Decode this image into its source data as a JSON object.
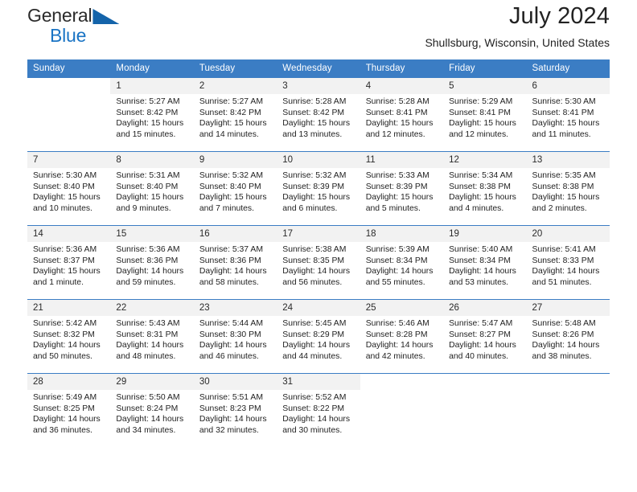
{
  "brand": {
    "name_top": "General",
    "name_bottom": "Blue",
    "triangle_color": "#1464aa",
    "bottom_color": "#1a74c4"
  },
  "header": {
    "title": "July 2024",
    "subtitle": "Shullsburg, Wisconsin, United States"
  },
  "theme": {
    "header_bg": "#3b7dc4",
    "daynum_bg": "#f2f2f2",
    "row_border": "#3b7dc4"
  },
  "weekday_headers": [
    "Sunday",
    "Monday",
    "Tuesday",
    "Wednesday",
    "Thursday",
    "Friday",
    "Saturday"
  ],
  "weeks": [
    [
      {
        "day": "",
        "sunrise": "",
        "sunset": "",
        "daylight_1": "",
        "daylight_2": ""
      },
      {
        "day": "1",
        "sunrise": "Sunrise: 5:27 AM",
        "sunset": "Sunset: 8:42 PM",
        "daylight_1": "Daylight: 15 hours",
        "daylight_2": "and 15 minutes."
      },
      {
        "day": "2",
        "sunrise": "Sunrise: 5:27 AM",
        "sunset": "Sunset: 8:42 PM",
        "daylight_1": "Daylight: 15 hours",
        "daylight_2": "and 14 minutes."
      },
      {
        "day": "3",
        "sunrise": "Sunrise: 5:28 AM",
        "sunset": "Sunset: 8:42 PM",
        "daylight_1": "Daylight: 15 hours",
        "daylight_2": "and 13 minutes."
      },
      {
        "day": "4",
        "sunrise": "Sunrise: 5:28 AM",
        "sunset": "Sunset: 8:41 PM",
        "daylight_1": "Daylight: 15 hours",
        "daylight_2": "and 12 minutes."
      },
      {
        "day": "5",
        "sunrise": "Sunrise: 5:29 AM",
        "sunset": "Sunset: 8:41 PM",
        "daylight_1": "Daylight: 15 hours",
        "daylight_2": "and 12 minutes."
      },
      {
        "day": "6",
        "sunrise": "Sunrise: 5:30 AM",
        "sunset": "Sunset: 8:41 PM",
        "daylight_1": "Daylight: 15 hours",
        "daylight_2": "and 11 minutes."
      }
    ],
    [
      {
        "day": "7",
        "sunrise": "Sunrise: 5:30 AM",
        "sunset": "Sunset: 8:40 PM",
        "daylight_1": "Daylight: 15 hours",
        "daylight_2": "and 10 minutes."
      },
      {
        "day": "8",
        "sunrise": "Sunrise: 5:31 AM",
        "sunset": "Sunset: 8:40 PM",
        "daylight_1": "Daylight: 15 hours",
        "daylight_2": "and 9 minutes."
      },
      {
        "day": "9",
        "sunrise": "Sunrise: 5:32 AM",
        "sunset": "Sunset: 8:40 PM",
        "daylight_1": "Daylight: 15 hours",
        "daylight_2": "and 7 minutes."
      },
      {
        "day": "10",
        "sunrise": "Sunrise: 5:32 AM",
        "sunset": "Sunset: 8:39 PM",
        "daylight_1": "Daylight: 15 hours",
        "daylight_2": "and 6 minutes."
      },
      {
        "day": "11",
        "sunrise": "Sunrise: 5:33 AM",
        "sunset": "Sunset: 8:39 PM",
        "daylight_1": "Daylight: 15 hours",
        "daylight_2": "and 5 minutes."
      },
      {
        "day": "12",
        "sunrise": "Sunrise: 5:34 AM",
        "sunset": "Sunset: 8:38 PM",
        "daylight_1": "Daylight: 15 hours",
        "daylight_2": "and 4 minutes."
      },
      {
        "day": "13",
        "sunrise": "Sunrise: 5:35 AM",
        "sunset": "Sunset: 8:38 PM",
        "daylight_1": "Daylight: 15 hours",
        "daylight_2": "and 2 minutes."
      }
    ],
    [
      {
        "day": "14",
        "sunrise": "Sunrise: 5:36 AM",
        "sunset": "Sunset: 8:37 PM",
        "daylight_1": "Daylight: 15 hours",
        "daylight_2": "and 1 minute."
      },
      {
        "day": "15",
        "sunrise": "Sunrise: 5:36 AM",
        "sunset": "Sunset: 8:36 PM",
        "daylight_1": "Daylight: 14 hours",
        "daylight_2": "and 59 minutes."
      },
      {
        "day": "16",
        "sunrise": "Sunrise: 5:37 AM",
        "sunset": "Sunset: 8:36 PM",
        "daylight_1": "Daylight: 14 hours",
        "daylight_2": "and 58 minutes."
      },
      {
        "day": "17",
        "sunrise": "Sunrise: 5:38 AM",
        "sunset": "Sunset: 8:35 PM",
        "daylight_1": "Daylight: 14 hours",
        "daylight_2": "and 56 minutes."
      },
      {
        "day": "18",
        "sunrise": "Sunrise: 5:39 AM",
        "sunset": "Sunset: 8:34 PM",
        "daylight_1": "Daylight: 14 hours",
        "daylight_2": "and 55 minutes."
      },
      {
        "day": "19",
        "sunrise": "Sunrise: 5:40 AM",
        "sunset": "Sunset: 8:34 PM",
        "daylight_1": "Daylight: 14 hours",
        "daylight_2": "and 53 minutes."
      },
      {
        "day": "20",
        "sunrise": "Sunrise: 5:41 AM",
        "sunset": "Sunset: 8:33 PM",
        "daylight_1": "Daylight: 14 hours",
        "daylight_2": "and 51 minutes."
      }
    ],
    [
      {
        "day": "21",
        "sunrise": "Sunrise: 5:42 AM",
        "sunset": "Sunset: 8:32 PM",
        "daylight_1": "Daylight: 14 hours",
        "daylight_2": "and 50 minutes."
      },
      {
        "day": "22",
        "sunrise": "Sunrise: 5:43 AM",
        "sunset": "Sunset: 8:31 PM",
        "daylight_1": "Daylight: 14 hours",
        "daylight_2": "and 48 minutes."
      },
      {
        "day": "23",
        "sunrise": "Sunrise: 5:44 AM",
        "sunset": "Sunset: 8:30 PM",
        "daylight_1": "Daylight: 14 hours",
        "daylight_2": "and 46 minutes."
      },
      {
        "day": "24",
        "sunrise": "Sunrise: 5:45 AM",
        "sunset": "Sunset: 8:29 PM",
        "daylight_1": "Daylight: 14 hours",
        "daylight_2": "and 44 minutes."
      },
      {
        "day": "25",
        "sunrise": "Sunrise: 5:46 AM",
        "sunset": "Sunset: 8:28 PM",
        "daylight_1": "Daylight: 14 hours",
        "daylight_2": "and 42 minutes."
      },
      {
        "day": "26",
        "sunrise": "Sunrise: 5:47 AM",
        "sunset": "Sunset: 8:27 PM",
        "daylight_1": "Daylight: 14 hours",
        "daylight_2": "and 40 minutes."
      },
      {
        "day": "27",
        "sunrise": "Sunrise: 5:48 AM",
        "sunset": "Sunset: 8:26 PM",
        "daylight_1": "Daylight: 14 hours",
        "daylight_2": "and 38 minutes."
      }
    ],
    [
      {
        "day": "28",
        "sunrise": "Sunrise: 5:49 AM",
        "sunset": "Sunset: 8:25 PM",
        "daylight_1": "Daylight: 14 hours",
        "daylight_2": "and 36 minutes."
      },
      {
        "day": "29",
        "sunrise": "Sunrise: 5:50 AM",
        "sunset": "Sunset: 8:24 PM",
        "daylight_1": "Daylight: 14 hours",
        "daylight_2": "and 34 minutes."
      },
      {
        "day": "30",
        "sunrise": "Sunrise: 5:51 AM",
        "sunset": "Sunset: 8:23 PM",
        "daylight_1": "Daylight: 14 hours",
        "daylight_2": "and 32 minutes."
      },
      {
        "day": "31",
        "sunrise": "Sunrise: 5:52 AM",
        "sunset": "Sunset: 8:22 PM",
        "daylight_1": "Daylight: 14 hours",
        "daylight_2": "and 30 minutes."
      },
      {
        "day": "",
        "sunrise": "",
        "sunset": "",
        "daylight_1": "",
        "daylight_2": ""
      },
      {
        "day": "",
        "sunrise": "",
        "sunset": "",
        "daylight_1": "",
        "daylight_2": ""
      },
      {
        "day": "",
        "sunrise": "",
        "sunset": "",
        "daylight_1": "",
        "daylight_2": ""
      }
    ]
  ]
}
